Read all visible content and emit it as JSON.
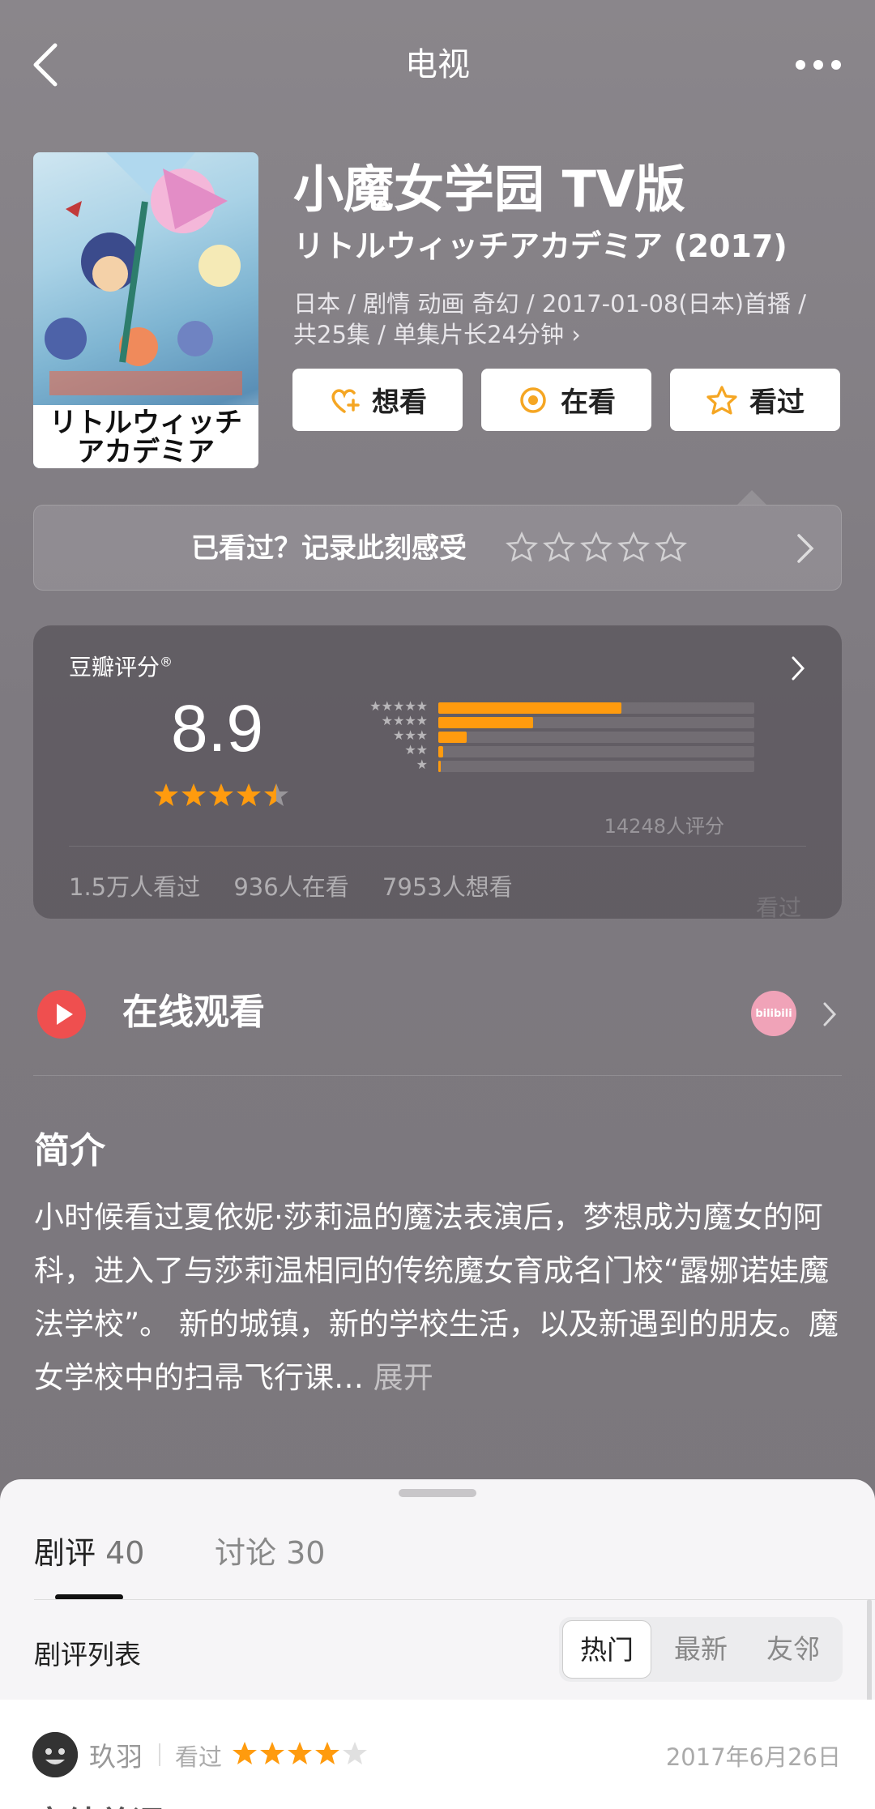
{
  "header": {
    "title": "电视"
  },
  "poster": {
    "caption_line1": "リトルウィッチ",
    "caption_line2": "アカデミア"
  },
  "movie": {
    "title": "小魔女学园 TV版",
    "original_title": "リトルウィッチアカデミア (2017)",
    "meta_line1": "日本 / 剧情 动画 奇幻 / 2017-01-08(日本)首播 /",
    "meta_line2": "共25集 / 单集片长24分钟 ›"
  },
  "actions": {
    "want": "想看",
    "watching": "在看",
    "watched": "看过"
  },
  "checkin": {
    "text": "已看过？记录此刻感受"
  },
  "rating": {
    "label": "豆瓣评分",
    "label_mark": "®",
    "score": "8.9",
    "stars": 4.5,
    "distribution": [
      {
        "stars": "★★★★★",
        "percent": 58
      },
      {
        "stars": "★★★★",
        "percent": 30
      },
      {
        "stars": "★★★",
        "percent": 9
      },
      {
        "stars": "★★",
        "percent": 1.5
      },
      {
        "stars": "★",
        "percent": 0.8
      }
    ],
    "count": "14248人评分",
    "stats": {
      "watched": "1.5万人看过",
      "watching": "936人在看",
      "want": "7953人想看"
    },
    "ghost": "看过"
  },
  "online": {
    "title": "在线观看",
    "provider": "bilibili"
  },
  "intro": {
    "title": "简介",
    "text": "小时候看过夏依妮·莎莉温的魔法表演后，梦想成为魔女的阿科，进入了与莎莉温相同的传统魔女育成名门校“露娜诺娃魔法学校”。 新的城镇，新的学校生活，以及新遇到的朋友。魔女学校中的扫帚飞行课… ",
    "expand": "展开"
  },
  "sheet": {
    "tabs": [
      {
        "label": "剧评",
        "count": "40"
      },
      {
        "label": "讨论",
        "count": "30"
      }
    ],
    "list_label": "剧评列表",
    "segments": [
      "热门",
      "最新",
      "友邻"
    ],
    "review": {
      "user": "玖羽",
      "status": "看过",
      "stars": 4,
      "date": "2017年6月26日",
      "title": "完结总评"
    }
  },
  "colors": {
    "accent": "#ff9b0e",
    "play": "#ef4f4f",
    "bilibili": "#f0a3b8"
  }
}
